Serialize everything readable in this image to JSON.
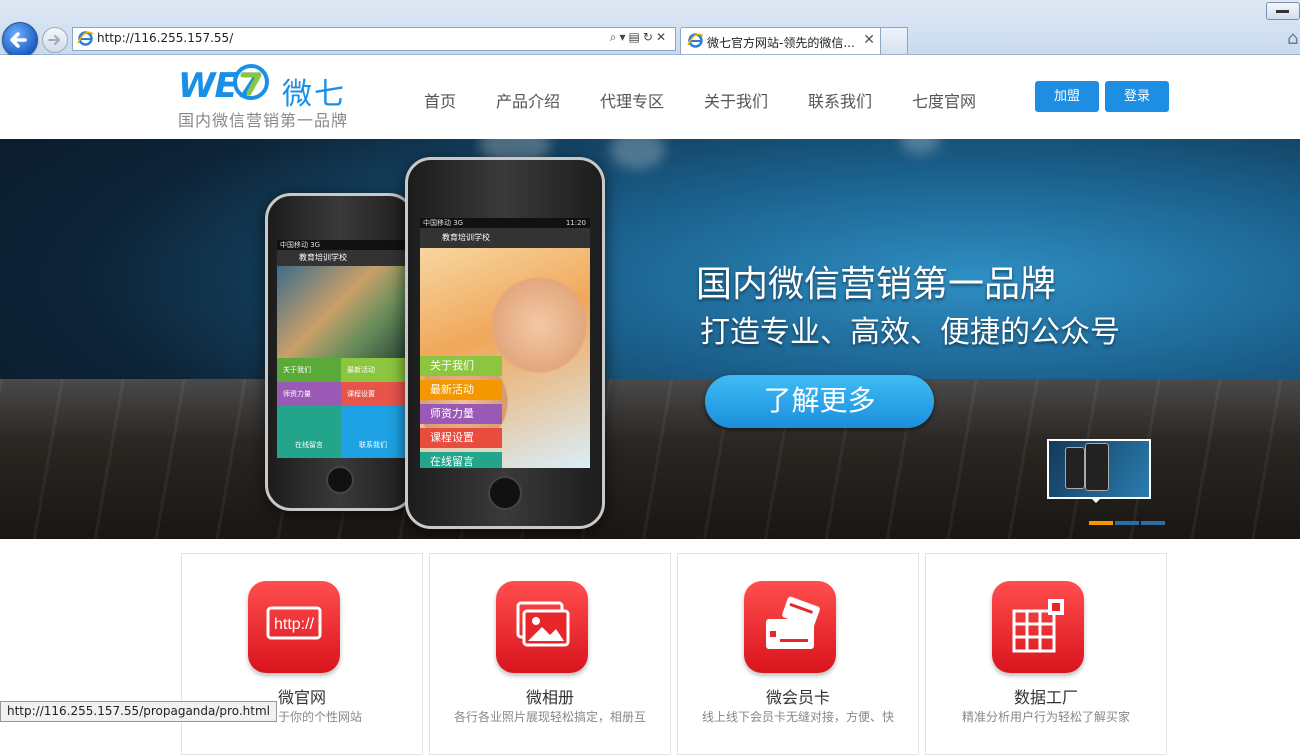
{
  "browser": {
    "address": "http://116.255.157.55/",
    "tab_title": "微七官方网站-领先的微信...",
    "status_url": "http://116.255.157.55/propaganda/pro.html"
  },
  "site": {
    "logo_text": "WE7",
    "logo_cn": "微七",
    "slogan": "国内微信营销第一品牌",
    "nav": [
      "首页",
      "产品介绍",
      "代理专区",
      "关于我们",
      "联系我们",
      "七度官网"
    ],
    "join_label": "加盟",
    "login_label": "登录",
    "accent": "#1e8ee2"
  },
  "banner": {
    "title": "国内微信营销第一品牌",
    "subtitle": "打造专业、高效、便捷的公众号",
    "cta": "了解更多",
    "dots_active_color": "#f39800",
    "dots_color": "#2a6ea8"
  },
  "phone_small": {
    "carrier": "中国移动 3G",
    "app_title": "教育培训学校",
    "tiles": [
      "关于我们",
      "最新活动",
      "师资力量",
      "课程设置",
      "在线留言",
      "联系我们"
    ]
  },
  "phone_large": {
    "carrier": "中国移动 3G",
    "time": "11:20",
    "app_title": "教育培训学校",
    "menu": [
      "关于我们",
      "最新活动",
      "师资力量",
      "课程设置",
      "在线留言"
    ]
  },
  "features": [
    {
      "icon": "http-icon",
      "icon_text": "http://",
      "title": "微官网",
      "desc": "打造属于你的个性网站"
    },
    {
      "icon": "photo-album-icon",
      "title": "微相册",
      "desc": "各行各业照片展现轻松搞定，相册互"
    },
    {
      "icon": "membership-card-icon",
      "title": "微会员卡",
      "desc": "线上线下会员卡无缝对接，方便、快"
    },
    {
      "icon": "grid-data-icon",
      "title": "数据工厂",
      "desc": "精准分析用户行为轻松了解买家"
    }
  ]
}
